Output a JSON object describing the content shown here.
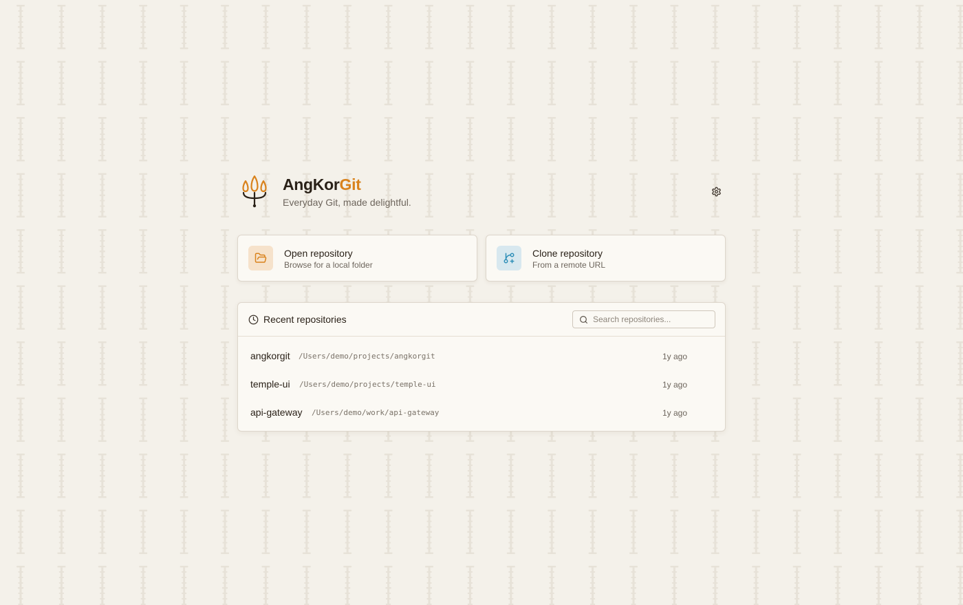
{
  "app": {
    "name_prefix": "AngKor",
    "name_accent": "Git",
    "tagline": "Everyday Git, made delightful."
  },
  "colors": {
    "accent": "#d9821c",
    "background": "#f4f1ea",
    "card": "#fbf9f4",
    "clone_icon": "#2f8fb8"
  },
  "icons": {
    "logo": "trident-lotus-icon",
    "settings": "gear-icon",
    "open": "folder-open-icon",
    "clone": "git-branch-plus-icon",
    "recent": "clock-icon",
    "search": "search-icon"
  },
  "actions": [
    {
      "title": "Open repository",
      "subtitle": "Browse for a local folder"
    },
    {
      "title": "Clone repository",
      "subtitle": "From a remote URL"
    }
  ],
  "recent": {
    "title": "Recent repositories",
    "search_placeholder": "Search repositories...",
    "search_value": "",
    "repos": [
      {
        "name": "angkorgit",
        "path": "/Users/demo/projects/angkorgit",
        "time": "1y ago"
      },
      {
        "name": "temple-ui",
        "path": "/Users/demo/projects/temple-ui",
        "time": "1y ago"
      },
      {
        "name": "api-gateway",
        "path": "/Users/demo/work/api-gateway",
        "time": "1y ago"
      }
    ]
  }
}
